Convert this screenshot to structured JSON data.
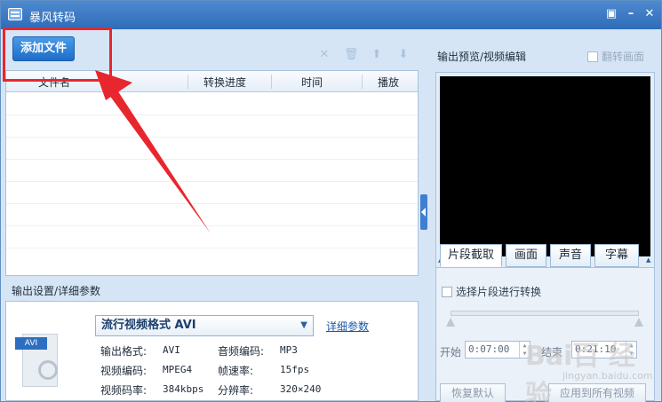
{
  "window": {
    "title": "暴风转码",
    "controls": [
      "▣",
      "–",
      "✕"
    ]
  },
  "toolbar": {
    "add_file_label": "添加文件",
    "icons": [
      "close-icon",
      "trash-icon",
      "arrow-up-icon",
      "arrow-down-icon"
    ],
    "icon_glyphs": [
      "✕",
      "🗑",
      "⬆",
      "⬇"
    ]
  },
  "file_list": {
    "columns": [
      "文件名",
      "转换进度",
      "时间",
      "播放"
    ],
    "rows": []
  },
  "output": {
    "section_label": "输出设置/详细参数",
    "format_selected": "流行视频格式 AVI",
    "detail_link": "详细参数",
    "icon_tag": "AVI",
    "params": [
      {
        "label": "输出格式:",
        "value": "AVI"
      },
      {
        "label": "音频编码:",
        "value": "MP3"
      },
      {
        "label": "视频编码:",
        "value": "MPEG4"
      },
      {
        "label": "帧速率:",
        "value": "15fps"
      },
      {
        "label": "视频码率:",
        "value": "384kbps"
      },
      {
        "label": "分辨率:",
        "value": "320×240"
      }
    ]
  },
  "preview": {
    "section_label": "输出预览/视频编辑",
    "flip_label": "翻转画面",
    "tabs": [
      "片段截取",
      "画面",
      "声音",
      "字幕"
    ],
    "active_tab": "片段截取",
    "segment_checkbox": "选择片段进行转换",
    "start_label": "开始",
    "start_time": "0:07:00",
    "end_label": "结束",
    "end_time": "0:21:10",
    "reset_button": "恢复默认",
    "apply_all_button": "应用到所有视频"
  },
  "watermark": {
    "text": "Bai百 经验",
    "sub": "jingyan.baidu.com"
  },
  "colors": {
    "accent": "#2f6cb8",
    "highlight": "#e8262e"
  }
}
